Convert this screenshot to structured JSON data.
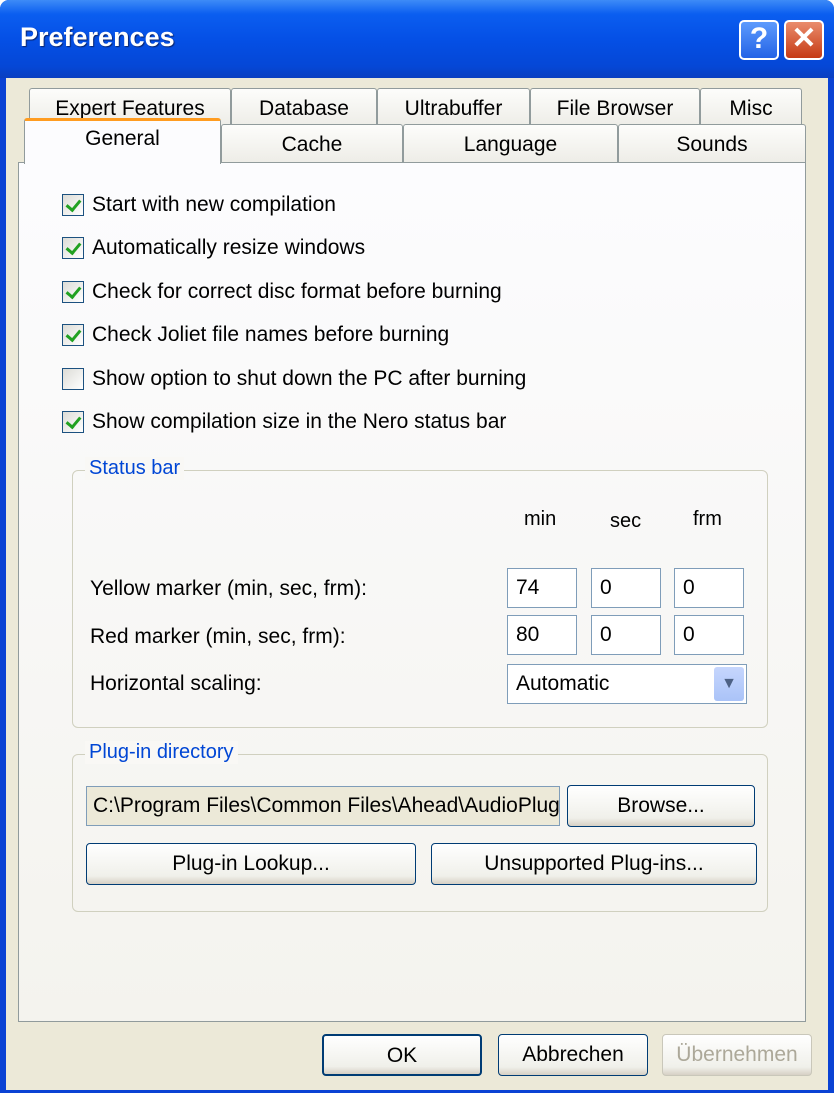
{
  "window": {
    "title": "Preferences",
    "help_label": "?",
    "close_label": "✕"
  },
  "tabs_row1": [
    "Expert Features",
    "Database",
    "Ultrabuffer",
    "File Browser",
    "Misc"
  ],
  "tabs_row2": [
    "General",
    "Cache",
    "Language",
    "Sounds"
  ],
  "active_tab": "General",
  "options": [
    {
      "label": "Start with new compilation",
      "checked": true
    },
    {
      "label": "Automatically resize windows",
      "checked": true
    },
    {
      "label": "Check for correct disc format before burning",
      "checked": true
    },
    {
      "label": "Check Joliet file names before burning",
      "checked": true
    },
    {
      "label": "Show option to shut down the PC after burning",
      "checked": false
    },
    {
      "label": "Show compilation size in the Nero status bar",
      "checked": true
    }
  ],
  "status_bar": {
    "legend": "Status bar",
    "col_min": "min",
    "col_sec": "sec",
    "col_frm": "frm",
    "yellow_label": "Yellow marker (min, sec, frm):",
    "yellow": {
      "min": "74",
      "sec": "0",
      "frm": "0"
    },
    "red_label": "Red marker (min, sec, frm):",
    "red": {
      "min": "80",
      "sec": "0",
      "frm": "0"
    },
    "scaling_label": "Horizontal scaling:",
    "scaling_value": "Automatic"
  },
  "plugin": {
    "legend": "Plug-in directory",
    "path": "C:\\Program Files\\Common Files\\Ahead\\AudioPlugins",
    "browse": "Browse...",
    "lookup": "Plug-in Lookup...",
    "unsupported": "Unsupported Plug-ins..."
  },
  "buttons": {
    "ok": "OK",
    "cancel": "Abbrechen",
    "apply": "Übernehmen"
  }
}
